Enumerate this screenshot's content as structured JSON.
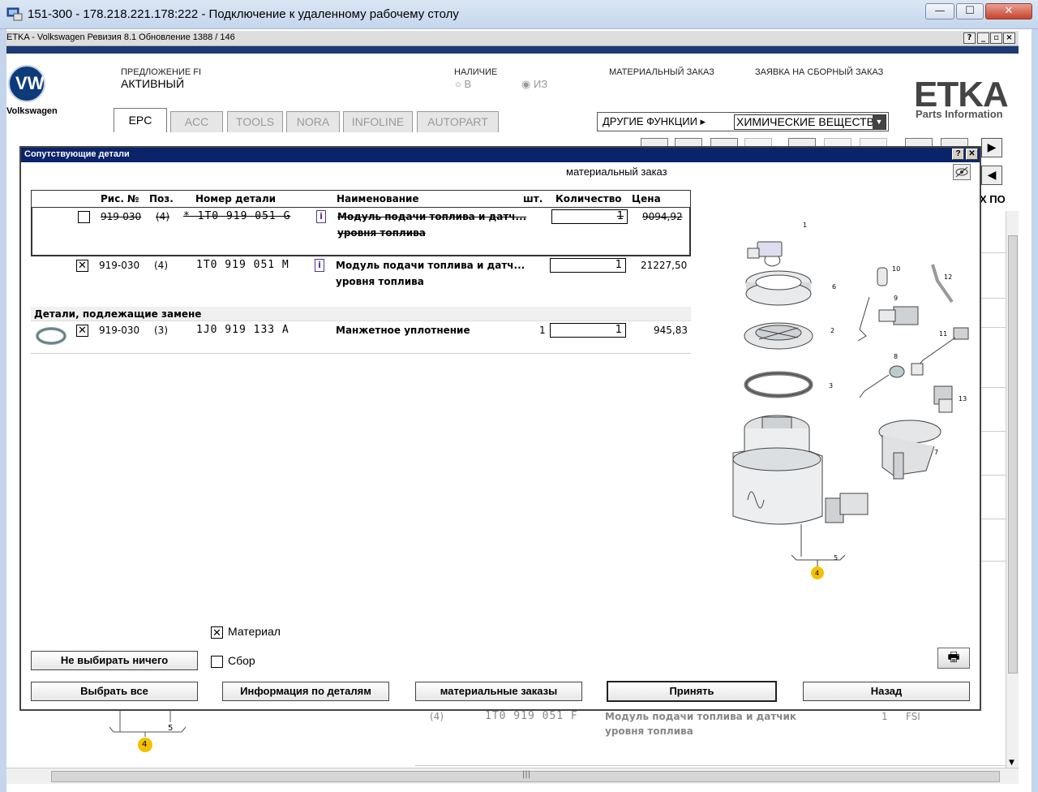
{
  "rdp": {
    "title": "151-300 - 178.218.221.178:222 - Подключение к удаленному рабочему столу",
    "min": "—",
    "max": "☐",
    "close": "✕"
  },
  "etka": {
    "title": "ETKA - Volkswagen Ревизия 8.1 Обновление 1388 / 146",
    "brand_text": "Volkswagen",
    "logo": "ETKA",
    "logo_sub": "Parts Information",
    "offer_label": "ПРЕДЛОЖЕНИЕ FI",
    "offer_status": "АКТИВНЫЙ",
    "availability_label": "НАЛИЧИЕ",
    "avail_in": "В",
    "avail_from": "ИЗ",
    "material_order_label": "МАТЕРИАЛЬНЫЙ ЗАКАЗ",
    "assembly_request_label": "ЗАЯВКА НА СБОРНЫЙ ЗАКАЗ",
    "tabs": [
      "EPC",
      "ACC",
      "TOOLS",
      "NORA",
      "INFOLINE",
      "AUTOPART"
    ],
    "other_functions": "ДРУГИЕ ФУНКЦИИ",
    "other_functions_value": "ХИМИЧЕСКИЕ ВЕЩЕСТВА",
    "bg_col_header": "Х ПО",
    "bg_row": {
      "pos": "(4)",
      "part": "1T0 919 051 F",
      "name1": "Модуль подачи топлива и датчик",
      "name2": "уровня топлива",
      "qty": "1",
      "note": "FSI"
    },
    "bg_label_4": "4",
    "bg_label_5": "5"
  },
  "dialog": {
    "title": "Сопутствующие детали",
    "help": "?",
    "close": "✕",
    "subtitle": "материальный заказ",
    "columns": {
      "fig": "Рис. №",
      "pos": "Поз.",
      "part": "Номер детали",
      "name": "Наименование",
      "pcs": "шт.",
      "qty": "Количество",
      "price": "Цена"
    },
    "rows": [
      {
        "fig": "919-030",
        "pos": "(4)",
        "part": "* 1T0 919 051 G",
        "info": "i",
        "name1": "Модуль подачи топлива и датч...",
        "name2": "уровня топлива",
        "pcs": "",
        "qty": "1",
        "price": "9094,92",
        "checked": "",
        "struck": true
      },
      {
        "fig": "919-030",
        "pos": "(4)",
        "part": "1T0 919 051 M",
        "info": "i",
        "name1": "Модуль подачи топлива и датч...",
        "name2": "уровня топлива",
        "pcs": "",
        "qty": "1",
        "price": "21227,50",
        "checked": "✕",
        "struck": false
      }
    ],
    "section_replace": "Детали, подлежащие замене",
    "replace_rows": [
      {
        "fig": "919-030",
        "pos": "(3)",
        "part": "1J0 919 133 A",
        "name1": "Манжетное уплотнение",
        "pcs": "1",
        "qty": "1",
        "price": "945,83",
        "checked": "✕"
      }
    ],
    "diagram_labels": [
      "1",
      "2",
      "3",
      "4",
      "5",
      "6",
      "7",
      "8",
      "9",
      "10",
      "11",
      "12",
      "13"
    ],
    "chk_material": "Материал",
    "chk_material_checked": "✕",
    "chk_assembly": "Сбор",
    "btn_select_none": "Не выбирать ничего",
    "btn_select_all": "Выбрать все",
    "btn_part_info": "Информация по деталям",
    "btn_material_orders": "материальные заказы",
    "btn_accept": "Принять",
    "btn_back": "Назад"
  },
  "colors": {
    "dialog_title_bg": "#0a246a",
    "etka_strip": "#1c3a76",
    "callout": "#f2c200"
  }
}
